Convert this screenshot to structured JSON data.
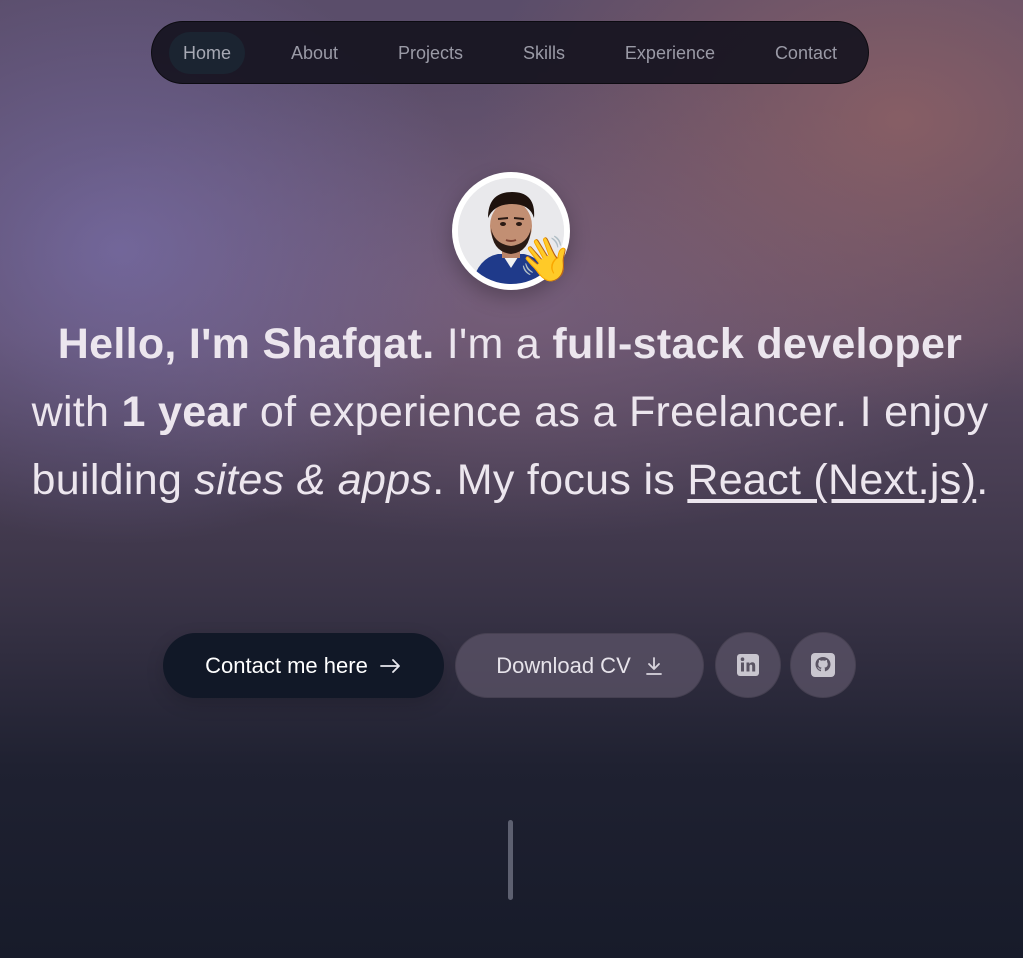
{
  "nav": {
    "items": [
      {
        "label": "Home",
        "active": true
      },
      {
        "label": "About",
        "active": false
      },
      {
        "label": "Projects",
        "active": false
      },
      {
        "label": "Skills",
        "active": false
      },
      {
        "label": "Experience",
        "active": false
      },
      {
        "label": "Contact",
        "active": false
      }
    ]
  },
  "hero": {
    "avatar_icon": "profile-photo",
    "wave_emoji": "👋",
    "headline": {
      "greeting": "Hello, I'm Shafqat.",
      "im_a": "I'm a",
      "role": "full-stack developer",
      "with": "with",
      "experience": "1 year",
      "experience_suffix": "of experience as a Freelancer. I enjoy building",
      "sites_apps": "sites & apps",
      "focus_prefix": ". My focus is",
      "focus": "React (Next.js)",
      "end": "."
    }
  },
  "actions": {
    "contact_label": "Contact me here",
    "contact_icon": "arrow-right-icon",
    "cv_label": "Download CV",
    "cv_icon": "download-icon",
    "linkedin_icon": "linkedin-icon",
    "github_icon": "github-icon"
  },
  "colors": {
    "primary_button": "#111827",
    "text": "#ece6ee",
    "nav_bg": "#16141f"
  }
}
